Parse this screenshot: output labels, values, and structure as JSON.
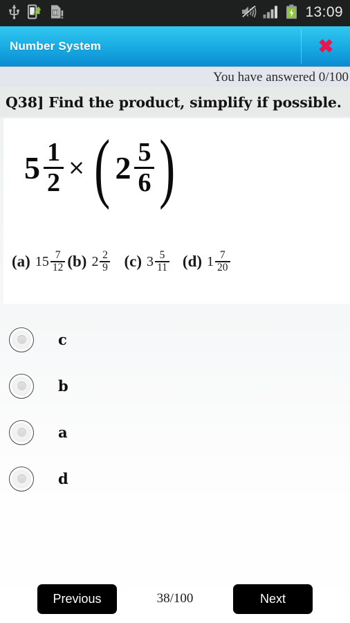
{
  "statusbar": {
    "icons": [
      "usb-icon",
      "phone-transfer-icon",
      "sd-card-icon",
      "mute-icon",
      "signal-bars-icon",
      "battery-charging-icon"
    ],
    "clock": "13:09"
  },
  "titlebar": {
    "title": "Number System",
    "close_label": "✖",
    "bg_start": "#31c8f0",
    "bg_end": "#0b8cd2",
    "close_color": "#e8174e"
  },
  "progress": {
    "answered_text": "You have answered 0/100"
  },
  "question": {
    "stem": "Q38]   Find the product, simplify if possible.",
    "expression": {
      "left_whole": "5",
      "left_num": "1",
      "left_den": "2",
      "operator": "×",
      "paren_open": "(",
      "right_whole": "2",
      "right_num": "5",
      "right_den": "6",
      "paren_close": ")"
    },
    "choices": [
      {
        "tag": "(a)",
        "whole": "15",
        "num": "7",
        "den": "12"
      },
      {
        "tag": "(b)",
        "whole": "2",
        "num": "2",
        "den": "9"
      },
      {
        "tag": "(c)",
        "whole": "3",
        "num": "5",
        "den": "11"
      },
      {
        "tag": "(d)",
        "whole": "1",
        "num": "7",
        "den": "20"
      }
    ]
  },
  "options": [
    {
      "label": "c",
      "selected": false
    },
    {
      "label": "b",
      "selected": false
    },
    {
      "label": "a",
      "selected": false
    },
    {
      "label": "d",
      "selected": false
    }
  ],
  "bottombar": {
    "previous_label": "Previous",
    "next_label": "Next",
    "counter": "38/100"
  }
}
